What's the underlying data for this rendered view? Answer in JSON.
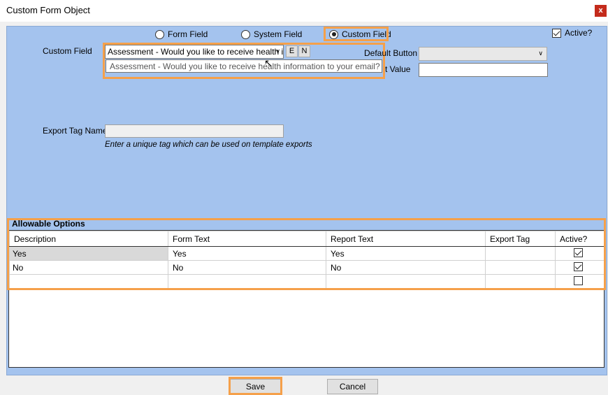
{
  "window": {
    "title": "Custom Form Object",
    "close_label": "x"
  },
  "field_type": {
    "options": [
      "Form Field",
      "System Field",
      "Custom Field"
    ],
    "selected": "Custom Field"
  },
  "active": {
    "label": "Active?",
    "checked": true
  },
  "custom_field": {
    "label": "Custom Field",
    "value": "Assessment - Would you like to receive health info",
    "edit_label": "E",
    "new_label": "N",
    "tooltip": "Assessment - Would you like to receive health information to your email?"
  },
  "default_button": {
    "label": "Default Button",
    "value": ""
  },
  "default_value": {
    "label": "t Value",
    "value": ""
  },
  "export_tag": {
    "label": "Export Tag Name",
    "value": "",
    "hint": "Enter a unique tag which can be used on template exports"
  },
  "allowable_options": {
    "title": "Allowable Options",
    "columns": [
      "Description",
      "Form Text",
      "Report Text",
      "Export Tag",
      "Active?"
    ],
    "rows": [
      {
        "description": "Yes",
        "form_text": "Yes",
        "report_text": "Yes",
        "export_tag": "",
        "active": true
      },
      {
        "description": "No",
        "form_text": "No",
        "report_text": "No",
        "export_tag": "",
        "active": true
      },
      {
        "description": "",
        "form_text": "",
        "report_text": "",
        "export_tag": "",
        "active": false
      }
    ]
  },
  "footer": {
    "save_label": "Save",
    "cancel_label": "Cancel"
  },
  "colors": {
    "panel": "#a4c3ee",
    "highlight": "#f5a04a",
    "close": "#c42b1c"
  }
}
